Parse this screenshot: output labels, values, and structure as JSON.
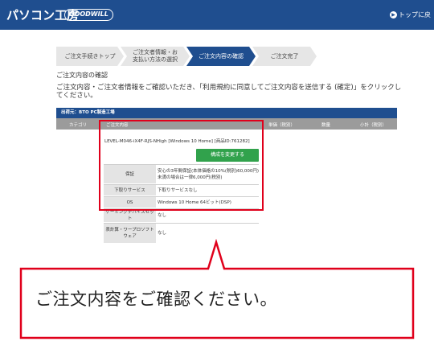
{
  "header": {
    "brand": "パソコン工房",
    "badge": "GOODWILL",
    "back_top": "トップに戻"
  },
  "steps": [
    {
      "label": "ご注文手続きトップ",
      "active": false
    },
    {
      "label": "ご注文者情報・お支払い方法の選択",
      "active": false
    },
    {
      "label": "ご注文内容の確認",
      "active": true
    },
    {
      "label": "ご注文完了",
      "active": false
    }
  ],
  "section_title": "ご注文内容の確認",
  "intro_text": "ご注文内容・ご注文者情報をご確認いただき、「利用規約に同意してご注文内容を送信する (確定)」をクリックしてください。",
  "table": {
    "shipper": "出荷元：BTO PC製造工場",
    "columns": {
      "category": "カテゴリ",
      "contents": "ご注文内容",
      "unit_price": "単価（税別）",
      "quantity": "数量",
      "subtotal": "小計（税別）"
    },
    "product": "LEVEL-M046-iX4F-RJS-NHigh [Windows 10 Home] [商品ID:761282]",
    "change_button": "構成を変更する",
    "rows": [
      {
        "label": "保証",
        "value": "安心の3年間保証(本体価格の10%(税別)60,000円)未満の場合は一律6,000円(税別)"
      },
      {
        "label": "下取りサービス",
        "value": "下取りサービスなし"
      },
      {
        "label": "OS",
        "value": "Windows 10 Home 64ビット(DSP)"
      },
      {
        "label": "ゲーミングデバイスセット",
        "value": "なし"
      },
      {
        "label": "表計算・ワープロソフトウェア",
        "value": "なし"
      }
    ]
  },
  "callout": "ご注文内容をご確認ください。",
  "colors": {
    "brand_blue": "#1f4e8f",
    "highlight_red": "#e0001b",
    "button_green": "#31a24c",
    "step_active": "#1f4e8f",
    "step_inactive": "#e6e6e6"
  }
}
